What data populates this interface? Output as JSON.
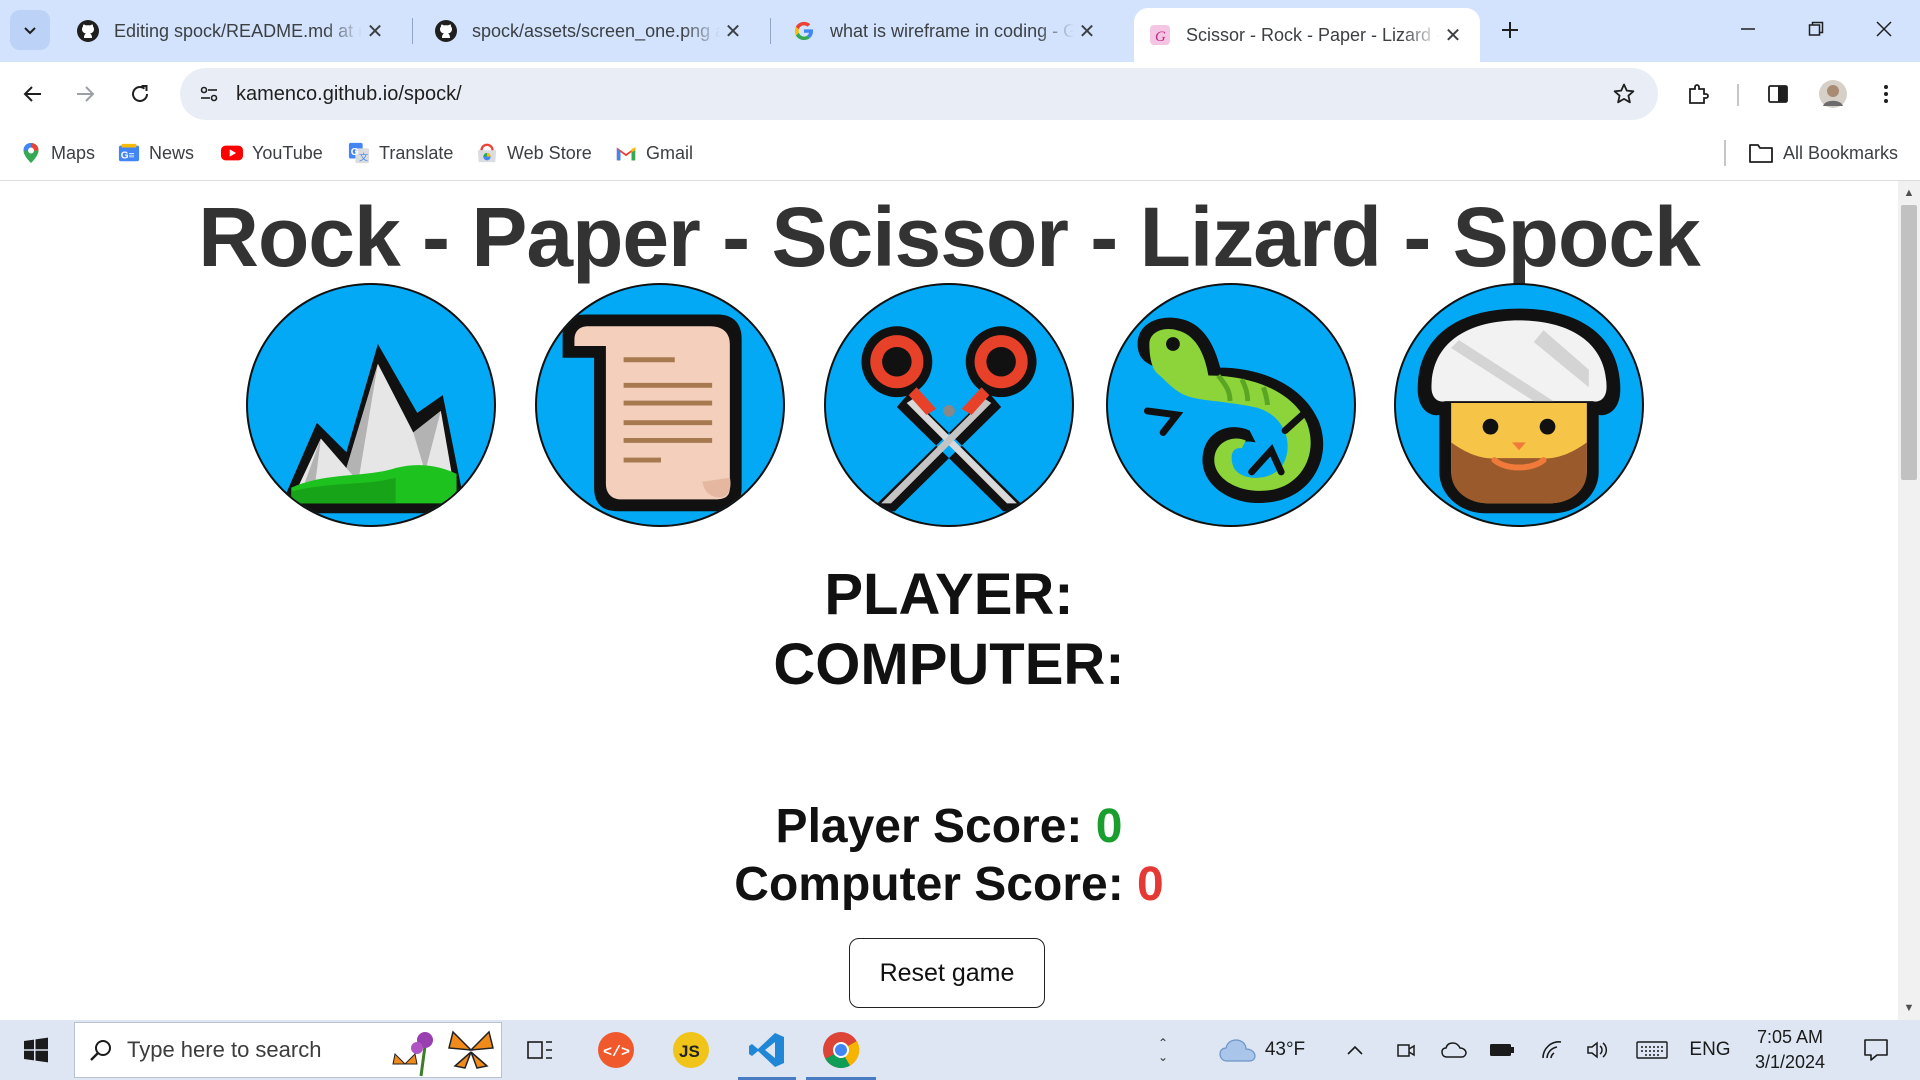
{
  "browser": {
    "tabs": [
      {
        "title": "Editing spock/README.md at m",
        "icon": "github-icon",
        "active": false
      },
      {
        "title": "spock/assets/screen_one.png at",
        "icon": "github-icon",
        "active": false
      },
      {
        "title": "what is wireframe in coding - G",
        "icon": "google-icon",
        "active": false
      },
      {
        "title": "Scissor - Rock - Paper - Lizard -",
        "icon": "site-favicon",
        "active": true
      }
    ],
    "url": "kamenco.github.io/spock/",
    "bookmarks": [
      {
        "label": "Maps",
        "icon": "maps-icon"
      },
      {
        "label": "News",
        "icon": "news-icon"
      },
      {
        "label": "YouTube",
        "icon": "youtube-icon"
      },
      {
        "label": "Translate",
        "icon": "translate-icon"
      },
      {
        "label": "Web Store",
        "icon": "webstore-icon"
      },
      {
        "label": "Gmail",
        "icon": "gmail-icon"
      }
    ],
    "all_bookmarks_label": "All Bookmarks"
  },
  "page": {
    "title": "Rock - Paper - Scissor - Lizard - Spock",
    "choices": [
      {
        "name": "rock",
        "icon": "mountain-icon"
      },
      {
        "name": "paper",
        "icon": "scroll-icon"
      },
      {
        "name": "scissors",
        "icon": "scissors-icon"
      },
      {
        "name": "lizard",
        "icon": "lizard-icon"
      },
      {
        "name": "spock",
        "icon": "turbaned-man-icon"
      }
    ],
    "player_label": "PLAYER:",
    "computer_label": "COMPUTER:",
    "player_score_label": "Player Score: ",
    "player_score": "0",
    "computer_score_label": "Computer Score: ",
    "computer_score": "0",
    "reset_label": "Reset game",
    "colors": {
      "circle": "#03a9f4",
      "player_score": "#1a9e2e",
      "computer_score": "#e53935",
      "title": "#333333"
    }
  },
  "taskbar": {
    "search_placeholder": "Type here to search",
    "apps": [
      "task-view-icon",
      "code-editor-icon",
      "js-icon",
      "vscode-icon",
      "chrome-icon"
    ],
    "weather": "43°F",
    "language": "ENG",
    "time": "7:05 AM",
    "date": "3/1/2024"
  }
}
